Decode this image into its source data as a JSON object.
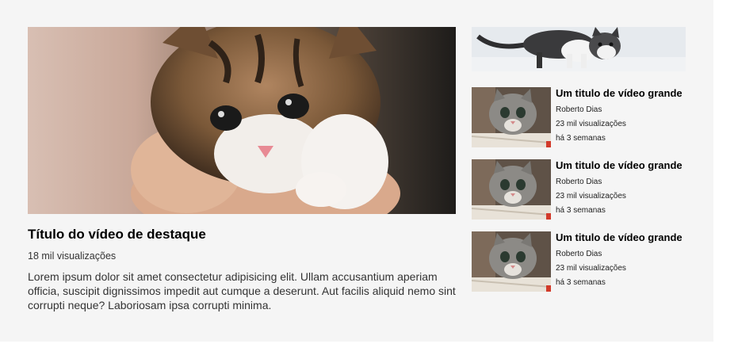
{
  "featured": {
    "title": "Título do vídeo de destaque",
    "views": "18 mil visualizações",
    "description": "Lorem ipsum dolor sit amet consectetur adipisicing elit. Ullam accusantium aperiam officia, suscipit dignissimos impedit aut cumque a deserunt. Aut facilis aliquid nemo sint corrupti neque? Laboriosam ipsa corrupti minima."
  },
  "sidebar": {
    "videos": [
      {
        "title": "Um titulo de vídeo grande",
        "channel": "Roberto Dias",
        "views": "23 mil visualizações",
        "time": "há 3 semanas"
      },
      {
        "title": "Um titulo de vídeo grande",
        "channel": "Roberto Dias",
        "views": "23 mil visualizações",
        "time": "há 3 semanas"
      },
      {
        "title": "Um titulo de vídeo grande",
        "channel": "Roberto Dias",
        "views": "23 mil visualizações",
        "time": "há 3 semanas"
      }
    ]
  }
}
